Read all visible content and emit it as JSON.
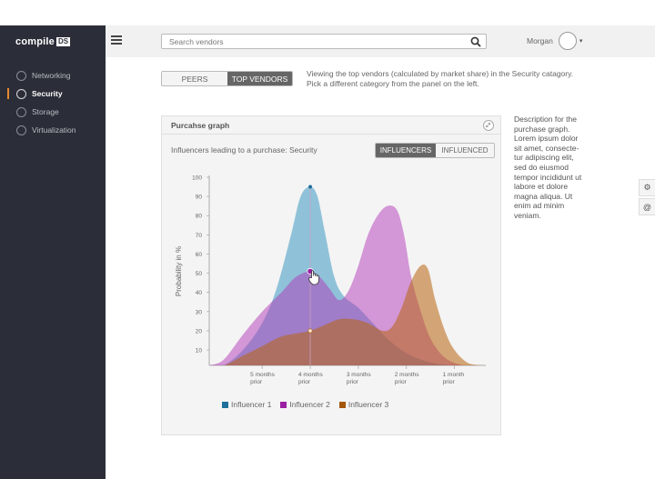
{
  "app": {
    "logo_text": "compile",
    "logo_badge": "DS"
  },
  "header": {
    "menu_icon": "hamburger-menu-icon",
    "search_placeholder": "Search vendors",
    "search_icon": "search-icon",
    "username": "Morgan",
    "caret": "▾"
  },
  "sidebar": {
    "items": [
      {
        "label": "Networking",
        "icon": "networking-icon",
        "active": false
      },
      {
        "label": "Security",
        "icon": "security-icon",
        "active": true
      },
      {
        "label": "Storage",
        "icon": "storage-icon",
        "active": false
      },
      {
        "label": "Virtualization",
        "icon": "virtualization-icon",
        "active": false
      }
    ],
    "accent": "#e8892f"
  },
  "main": {
    "tabs": [
      "PEERS",
      "TOP VENDORS"
    ],
    "active_tab": "TOP VENDORS",
    "intro": "Viewing the top vendors (calculated by market share) in the Security catagory. Pick a different category from the panel on the left."
  },
  "panel": {
    "title": "Purcahse graph",
    "subtitle": "Influencers leading to a purchase: Security",
    "toggle": [
      "INFLUENCERS",
      "INFLUENCED"
    ],
    "active_toggle": "INFLUENCERS"
  },
  "description": "Description for the purchase graph. Lorem ipsum dolor sit amet, consecte-tur adipiscing elit, sed do eiusmod tempor incididunt ut labore et dolore magna aliqua. Ut enim ad minim veniam.",
  "tools": [
    "gear-icon",
    "at-icon"
  ],
  "chart_data": {
    "type": "area",
    "ylabel": "Probability in %",
    "ylim": [
      0,
      100
    ],
    "yticks": [
      10,
      20,
      30,
      40,
      50,
      60,
      70,
      80,
      90,
      100
    ],
    "x_ticks": [
      {
        "x": -5,
        "l1": "5 months",
        "l2": "prior"
      },
      {
        "x": -4,
        "l1": "4 months",
        "l2": "prior"
      },
      {
        "x": -3,
        "l1": "3 months",
        "l2": "prior"
      },
      {
        "x": -2,
        "l1": "2 months",
        "l2": "prior"
      },
      {
        "x": -1,
        "l1": "1 month",
        "l2": "prior"
      }
    ],
    "xlim": [
      -6.1,
      -0.35
    ],
    "grid": false,
    "legend_position": "bottom",
    "marker_x": -4,
    "series": [
      {
        "name": "Influencer 1",
        "color": "#2a8fbd",
        "points": [
          [
            -6.1,
            0
          ],
          [
            -5.8,
            2
          ],
          [
            -5.4,
            10
          ],
          [
            -5.0,
            24
          ],
          [
            -4.7,
            42
          ],
          [
            -4.4,
            70
          ],
          [
            -4.2,
            90
          ],
          [
            -4.0,
            95
          ],
          [
            -3.85,
            90
          ],
          [
            -3.7,
            72
          ],
          [
            -3.5,
            48
          ],
          [
            -3.3,
            38
          ],
          [
            -3.0,
            32
          ],
          [
            -2.7,
            24
          ],
          [
            -2.4,
            16
          ],
          [
            -2.1,
            10
          ],
          [
            -1.8,
            6
          ],
          [
            -1.4,
            3
          ],
          [
            -1.0,
            1
          ],
          [
            -0.35,
            0
          ]
        ]
      },
      {
        "name": "Influencer 2",
        "color": "#b137b8",
        "points": [
          [
            -6.1,
            0
          ],
          [
            -5.8,
            5
          ],
          [
            -5.4,
            18
          ],
          [
            -5.0,
            30
          ],
          [
            -4.6,
            40
          ],
          [
            -4.3,
            48
          ],
          [
            -4.0,
            51
          ],
          [
            -3.8,
            48
          ],
          [
            -3.6,
            42
          ],
          [
            -3.4,
            36
          ],
          [
            -3.2,
            41
          ],
          [
            -3.0,
            54
          ],
          [
            -2.8,
            70
          ],
          [
            -2.6,
            80
          ],
          [
            -2.4,
            85
          ],
          [
            -2.2,
            83
          ],
          [
            -2.05,
            70
          ],
          [
            -1.9,
            48
          ],
          [
            -1.7,
            30
          ],
          [
            -1.5,
            16
          ],
          [
            -1.2,
            6
          ],
          [
            -0.8,
            1
          ],
          [
            -0.35,
            0
          ]
        ]
      },
      {
        "name": "Influencer 3",
        "color": "#b8650f",
        "points": [
          [
            -6.1,
            0
          ],
          [
            -5.8,
            2
          ],
          [
            -5.4,
            7
          ],
          [
            -5.0,
            12
          ],
          [
            -4.6,
            17
          ],
          [
            -4.2,
            19
          ],
          [
            -4.0,
            20
          ],
          [
            -3.7,
            23
          ],
          [
            -3.4,
            26
          ],
          [
            -3.1,
            26
          ],
          [
            -2.8,
            24
          ],
          [
            -2.5,
            20
          ],
          [
            -2.3,
            22
          ],
          [
            -2.1,
            32
          ],
          [
            -1.9,
            46
          ],
          [
            -1.7,
            54
          ],
          [
            -1.55,
            52
          ],
          [
            -1.4,
            36
          ],
          [
            -1.2,
            20
          ],
          [
            -1.0,
            10
          ],
          [
            -0.7,
            3
          ],
          [
            -0.35,
            0
          ]
        ]
      }
    ]
  }
}
